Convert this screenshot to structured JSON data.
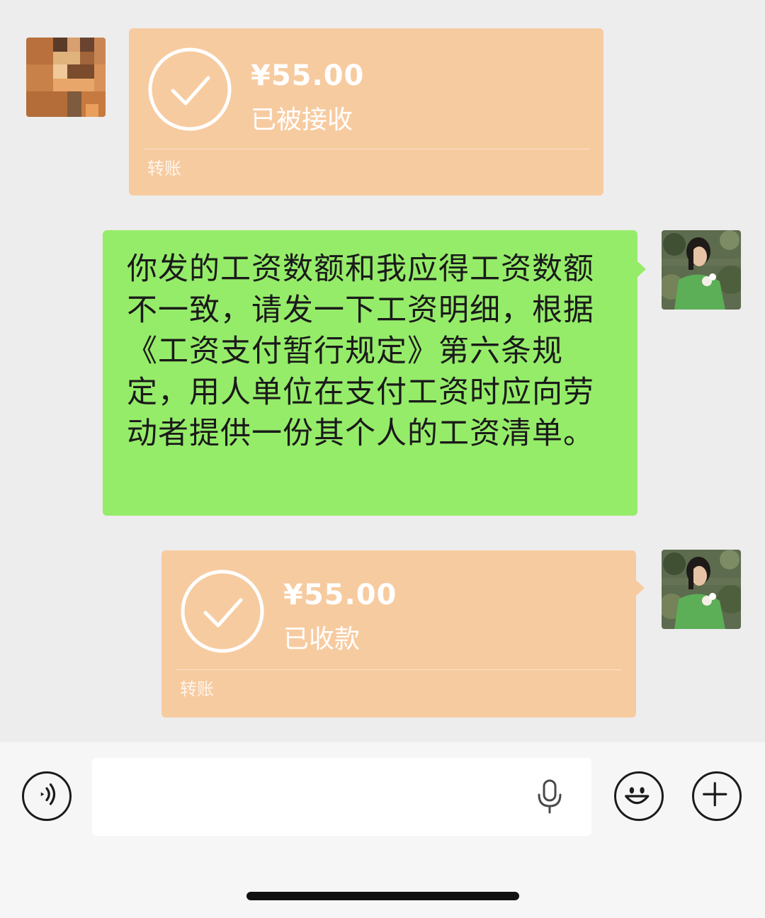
{
  "chat": {
    "messages": [
      {
        "type": "transfer",
        "side": "left",
        "amount": "¥55.00",
        "status": "已被接收",
        "label": "转账"
      },
      {
        "type": "text",
        "side": "right",
        "text": "你发的工资数额和我应得工资数额不一致，请发一下工资明细，根据《工资支付暂行规定》第六条规定，用人单位在支付工资时应向劳动者提供一份其个人的工资清单。"
      },
      {
        "type": "transfer",
        "side": "right",
        "amount": "¥55.00",
        "status": "已收款",
        "label": "转账"
      }
    ]
  },
  "input_bar": {
    "text_value": "",
    "icons": [
      "voice-mode-icon",
      "microphone-icon",
      "emoji-icon",
      "plus-icon"
    ]
  },
  "colors": {
    "background": "#ededed",
    "transfer_bubble": "#f7cba0",
    "text_bubble": "#95ec69"
  }
}
